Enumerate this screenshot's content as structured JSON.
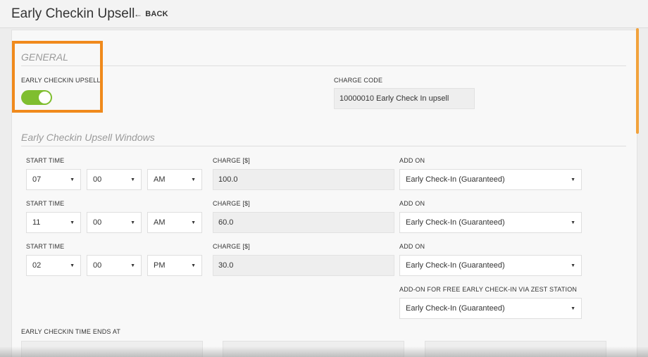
{
  "header": {
    "title": "Early Checkin Upsell",
    "back_label": "BACK"
  },
  "general": {
    "section_title": "GENERAL",
    "upsell_label": "EARLY CHECKIN UPSELL",
    "upsell_enabled": true,
    "charge_code_label": "CHARGE CODE",
    "charge_code_value": "10000010 Early Check In upsell"
  },
  "windows": {
    "section_title": "Early Checkin Upsell Windows",
    "rows": [
      {
        "start_label": "START TIME",
        "hour": "07",
        "minute": "00",
        "ampm": "AM",
        "charge_label": "CHARGE [$]",
        "charge": "100.0",
        "addon_label": "ADD ON",
        "addon": "Early Check-In (Guaranteed)"
      },
      {
        "start_label": "START TIME",
        "hour": "11",
        "minute": "00",
        "ampm": "AM",
        "charge_label": "CHARGE [$]",
        "charge": "60.0",
        "addon_label": "ADD ON",
        "addon": "Early Check-In (Guaranteed)"
      },
      {
        "start_label": "START TIME",
        "hour": "02",
        "minute": "00",
        "ampm": "PM",
        "charge_label": "CHARGE [$]",
        "charge": "30.0",
        "addon_label": "ADD ON",
        "addon": "Early Check-In (Guaranteed)"
      }
    ],
    "zest_label": "ADD-ON FOR FREE EARLY CHECK-IN VIA ZEST STATION",
    "zest_value": "Early Check-In (Guaranteed)",
    "ends_label": "EARLY CHECKIN TIME ENDS AT"
  },
  "colors": {
    "accent_orange": "#f08a1c",
    "toggle_green": "#7fbe2f"
  }
}
